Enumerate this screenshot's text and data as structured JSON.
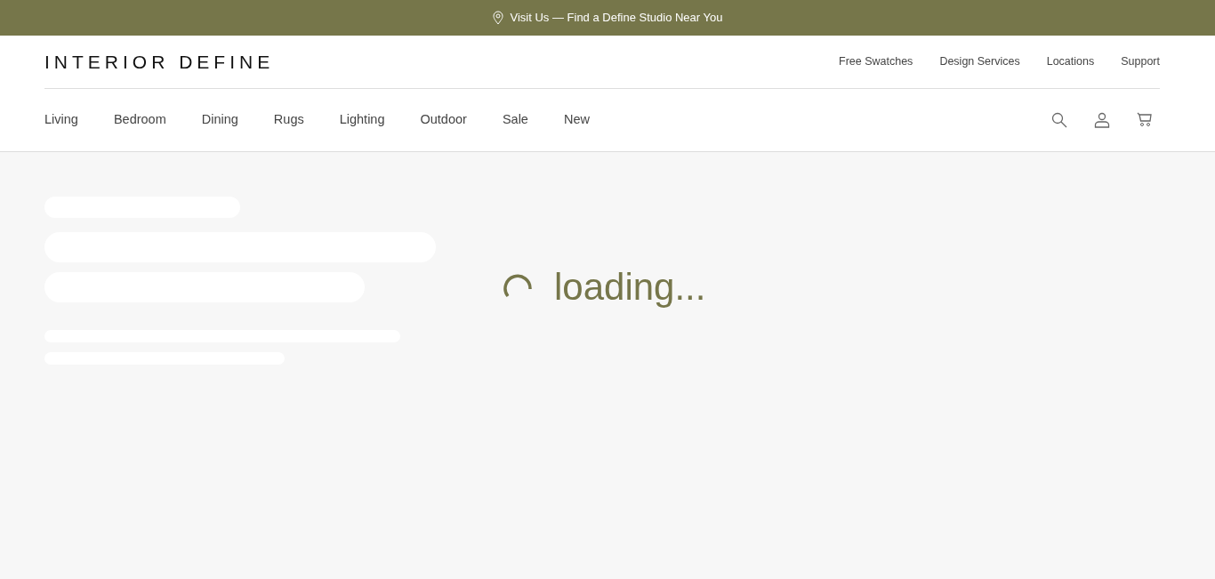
{
  "promo_banner": {
    "text": "Visit Us — Find a Define Studio Near You"
  },
  "header": {
    "logo": "INTERIOR DEFINE",
    "utility_links": [
      "Free Swatches",
      "Design Services",
      "Locations",
      "Support"
    ],
    "nav_items": [
      "Living",
      "Bedroom",
      "Dining",
      "Rugs",
      "Lighting",
      "Outdoor",
      "Sale",
      "New"
    ]
  },
  "main": {
    "loading_text": "loading..."
  }
}
